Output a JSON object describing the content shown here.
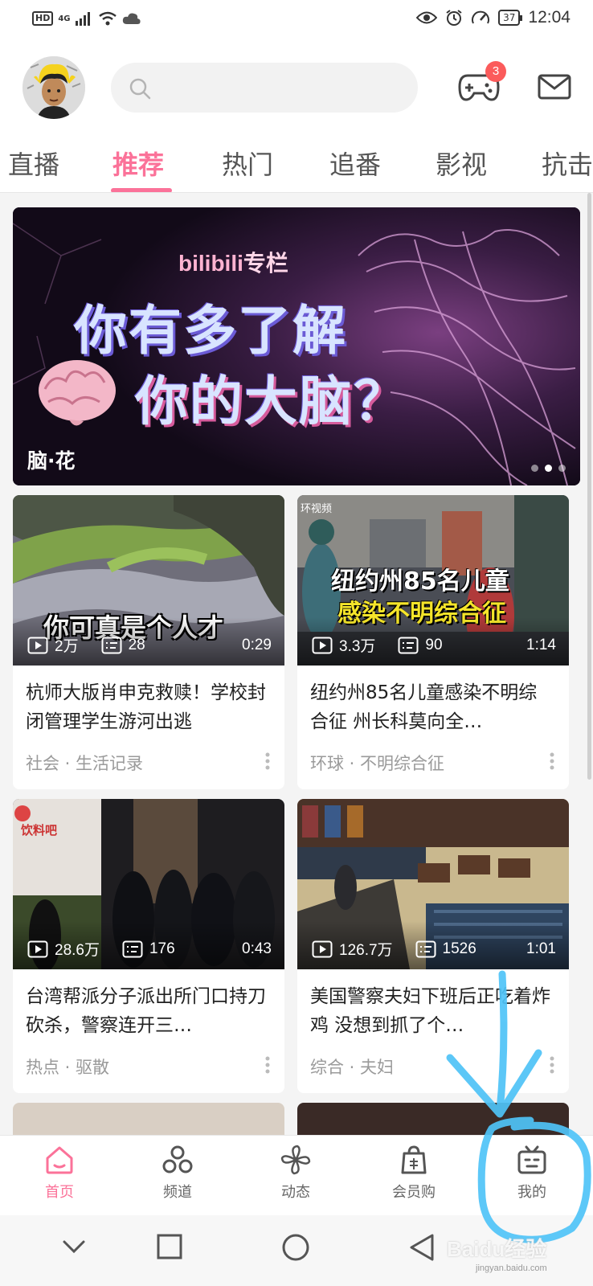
{
  "status_bar": {
    "hd": "HD",
    "network": "4G",
    "battery": "37",
    "time": "12:04"
  },
  "header": {
    "game_badge_count": "3"
  },
  "tabs": [
    {
      "label": "直播"
    },
    {
      "label": "推荐"
    },
    {
      "label": "热门"
    },
    {
      "label": "追番"
    },
    {
      "label": "影视"
    },
    {
      "label": "抗击"
    }
  ],
  "active_tab": "推荐",
  "banner": {
    "brand_bili": "bilibili",
    "brand_zl": "专栏",
    "line1": "你有多了解",
    "line2": "你的大脑？",
    "caption": "脑·花"
  },
  "cards": [
    {
      "thumb_text": "你可真是个人才",
      "plays": "2万",
      "danmaku": "28",
      "duration": "0:29",
      "title": "杭师大版肖申克救赎！学校封闭管理学生游河出逃",
      "meta": "社会 · 生活记录"
    },
    {
      "thumb_source": "环视频",
      "thumb_text_1": "纽约州85名儿童",
      "thumb_text_2": "感染不明综合征",
      "plays": "3.3万",
      "danmaku": "90",
      "duration": "1:14",
      "title": "纽约州85名儿童感染不明综合征 州长科莫向全…",
      "meta": "环球 · 不明综合征"
    },
    {
      "thumb_sign": "饮料吧",
      "plays": "28.6万",
      "danmaku": "176",
      "duration": "0:43",
      "title": "台湾帮派分子派出所门口持刀砍杀，警察连开三…",
      "meta": "热点 · 驱散"
    },
    {
      "plays": "126.7万",
      "danmaku": "1526",
      "duration": "1:01",
      "title": "美国警察夫妇下班后正吃着炸鸡 没想到抓了个…",
      "meta": "综合 · 夫妇"
    }
  ],
  "bottom_nav": [
    {
      "label": "首页",
      "icon": "home-icon"
    },
    {
      "label": "频道",
      "icon": "channel-icon"
    },
    {
      "label": "动态",
      "icon": "pinwheel-icon"
    },
    {
      "label": "会员购",
      "icon": "shopping-bag-icon"
    },
    {
      "label": "我的",
      "icon": "tv-icon"
    }
  ],
  "active_nav": "首页",
  "watermark": {
    "text": "Baidu经验",
    "sub": "jingyan.baidu.com"
  },
  "colors": {
    "accent": "#fb7299",
    "badge": "#fb5b5b",
    "annotation": "#4fc3f7"
  }
}
